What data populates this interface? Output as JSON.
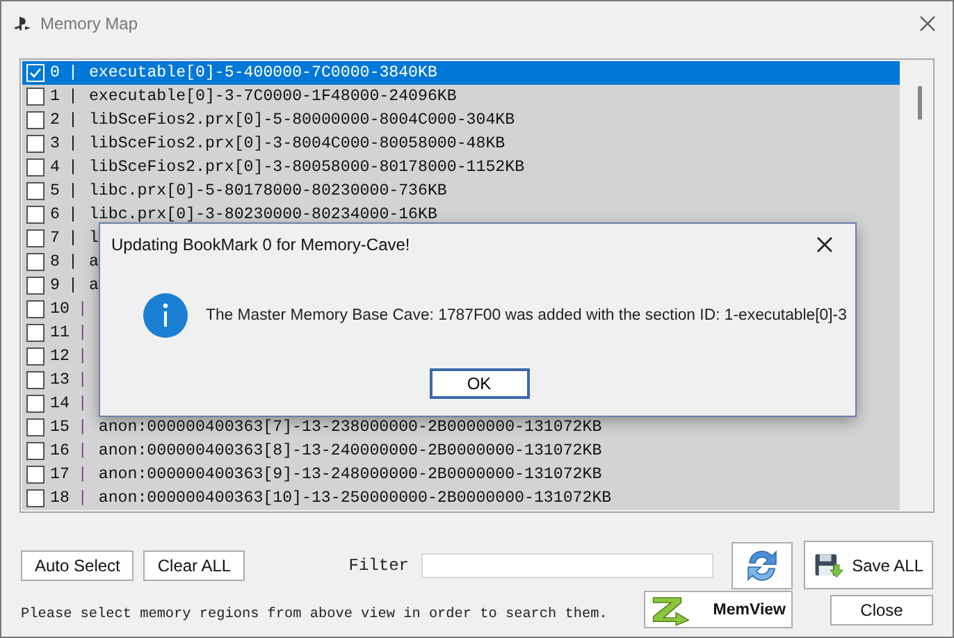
{
  "window": {
    "title": "Memory Map"
  },
  "regions": [
    {
      "index": "0",
      "separator": "|",
      "text": "executable[0]-5-400000-7C0000-3840KB",
      "checked": true,
      "selected": true
    },
    {
      "index": "1",
      "separator": "|",
      "text": "executable[0]-3-7C0000-1F48000-24096KB",
      "checked": false,
      "selected": false
    },
    {
      "index": "2",
      "separator": "|",
      "text": "libSceFios2.prx[0]-5-80000000-8004C000-304KB",
      "checked": false,
      "selected": false
    },
    {
      "index": "3",
      "separator": "|",
      "text": "libSceFios2.prx[0]-3-8004C000-80058000-48KB",
      "checked": false,
      "selected": false
    },
    {
      "index": "4",
      "separator": "|",
      "text": "libSceFios2.prx[0]-3-80058000-80178000-1152KB",
      "checked": false,
      "selected": false
    },
    {
      "index": "5",
      "separator": "|",
      "text": "libc.prx[0]-5-80178000-80230000-736KB",
      "checked": false,
      "selected": false
    },
    {
      "index": "6",
      "separator": "|",
      "text": "libc.prx[0]-3-80230000-80234000-16KB",
      "checked": false,
      "selected": false
    },
    {
      "index": "7",
      "separator": "|",
      "text": "l",
      "checked": false,
      "selected": false
    },
    {
      "index": "8",
      "separator": "|",
      "text": "a",
      "checked": false,
      "selected": false
    },
    {
      "index": "9",
      "separator": "|",
      "text": "a",
      "checked": false,
      "selected": false
    },
    {
      "index": "10",
      "separator": "|",
      "checked": false,
      "selected": false
    },
    {
      "index": "11",
      "separator": "|",
      "checked": false,
      "selected": false
    },
    {
      "index": "12",
      "separator": "|",
      "checked": false,
      "selected": false
    },
    {
      "index": "13",
      "separator": "|",
      "checked": false,
      "selected": false
    },
    {
      "index": "14",
      "separator": "|",
      "checked": false,
      "selected": false
    },
    {
      "index": "15",
      "separator": "|",
      "text": "anon:000000400363[7]-13-238000000-2B0000000-131072KB",
      "checked": false,
      "selected": false
    },
    {
      "index": "16",
      "separator": "|",
      "text": "anon:000000400363[8]-13-240000000-2B0000000-131072KB",
      "checked": false,
      "selected": false
    },
    {
      "index": "17",
      "separator": "|",
      "text": "anon:000000400363[9]-13-248000000-2B0000000-131072KB",
      "checked": false,
      "selected": false
    },
    {
      "index": "18",
      "separator": "|",
      "text": "anon:000000400363[10]-13-250000000-2B0000000-131072KB",
      "checked": false,
      "selected": false
    }
  ],
  "buttons": {
    "auto_select": "Auto Select",
    "clear_all": "Clear ALL",
    "save_all": "Save ALL",
    "memview": "MemView",
    "close": "Close"
  },
  "filter": {
    "label": "Filter"
  },
  "status": "Please select memory regions from above view in order to search them.",
  "dialog": {
    "title": "Updating BookMark 0 for Memory-Cave!",
    "message": "The Master Memory Base Cave: 1787F00 was added with the section ID: 1-executable[0]-3",
    "ok": "OK"
  }
}
